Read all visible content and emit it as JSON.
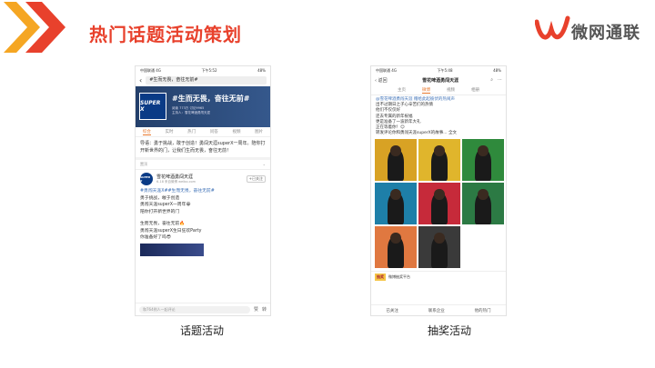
{
  "slide": {
    "title": "热门话题活动策划",
    "brand": "微网通联",
    "colors": {
      "accent": "#e8412c",
      "chevron_orange": "#f5a623",
      "chevron_red": "#e8412c",
      "weibo_orange": "#e8782c",
      "link_blue": "#3b6fb6"
    }
  },
  "phone_topic": {
    "status": {
      "carrier": "中国联通 4G",
      "time": "下午5:52",
      "battery": "48%"
    },
    "search_text": "#生而无畏，奋往无前#",
    "hero": {
      "avatar_text": "SUPER X",
      "topic": "#生而无畏，奋往无前#",
      "stats_line1": "阅读 773万  讨论9965",
      "stats_line2": "主持人：雪花啤酒勇闯天涯"
    },
    "tabs": [
      "综合",
      "实时",
      "热门",
      "问答",
      "视频",
      "图片"
    ],
    "guide": "导语：勇于挑战，敢于创造！勇闯天涯superX一周年。陪你打开新世界的门，让我们生而无畏，奋往无前！",
    "section_label": "置顶",
    "post": {
      "avatar_text": "SUPER X",
      "name": "雪花啤酒勇闯天涯",
      "meta": "6-18 来自微博 weibo.com",
      "follow": "+已关注",
      "tags": "#勇闯天涯X##生而无畏，奋往无前#",
      "lines": [
        "勇于挑战，敢于创造",
        "勇闯天涯superX一周年😀",
        "陪你打开新世界的门",
        "",
        "生而无畏，奋往无前🔥",
        "勇闯天涯superX生日狂欢Party",
        "你准备好了吗😎"
      ]
    },
    "comment_placeholder": "和764例人一起评论",
    "actions": [
      "赞",
      "转"
    ],
    "caption": "话题活动"
  },
  "phone_lottery": {
    "status": {
      "carrier": "中国联通 4G",
      "time": "下午5:48",
      "battery": "48%"
    },
    "back": "‹ 返回",
    "account": "雪花啤酒勇闯天涯",
    "tabs": [
      "主页",
      "微博",
      "视频",
      "相册"
    ],
    "text_lines": [
      "@雪花啤酒勇闯天涯 赠给此起彼伏的热闹声",
      "出不过期日之子心辛苦们的热情",
      "他们不仅仅好",
      "还去专属的新年祝福",
      "更是准备了一波新年大礼",
      "正在等着你！😉",
      "转发评论你和勇闯天涯superX的故事... 全文"
    ],
    "photo_colors": [
      "#d8a224",
      "#e0b52c",
      "#2f8a3c",
      "#1e7fa8",
      "#c62a3a",
      "#2c7a44",
      "#e07840",
      "#3a3a3a",
      "#ffffff"
    ],
    "prize_badge": "抽奖",
    "prize_text": "微博抽奖平台",
    "bottom": [
      "已关注",
      "联系企业",
      "他的热门"
    ],
    "caption": "抽奖活动"
  }
}
